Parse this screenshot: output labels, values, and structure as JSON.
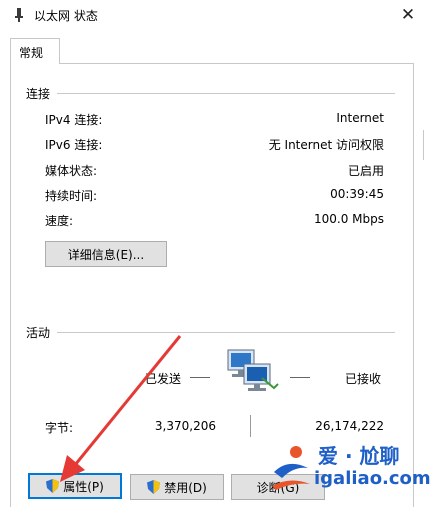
{
  "window": {
    "title": "以太网 状态"
  },
  "tabs": [
    {
      "label": "常规"
    }
  ],
  "connection": {
    "heading": "连接",
    "rows": [
      {
        "label": "IPv4 连接:",
        "value": "Internet"
      },
      {
        "label": "IPv6 连接:",
        "value": "无 Internet 访问权限"
      },
      {
        "label": "媒体状态:",
        "value": "已启用"
      },
      {
        "label": "持续时间:",
        "value": "00:39:45"
      },
      {
        "label": "速度:",
        "value": "100.0 Mbps"
      }
    ],
    "details_button": "详细信息(E)..."
  },
  "activity": {
    "heading": "活动",
    "sent_label": "已发送",
    "received_label": "已接收",
    "bytes_label": "字节:",
    "bytes_sent": "3,370,206",
    "bytes_received": "26,174,222"
  },
  "buttons": {
    "properties": "属性(P)",
    "disable": "禁用(D)",
    "diagnose": "诊断(G)"
  },
  "watermark": {
    "top": "爱 · 尬聊",
    "bottom": "igaliao.com"
  },
  "colors": {
    "focus": "#0078d7",
    "annotation_arrow": "#e53935",
    "watermark": "#1e5fc8"
  }
}
